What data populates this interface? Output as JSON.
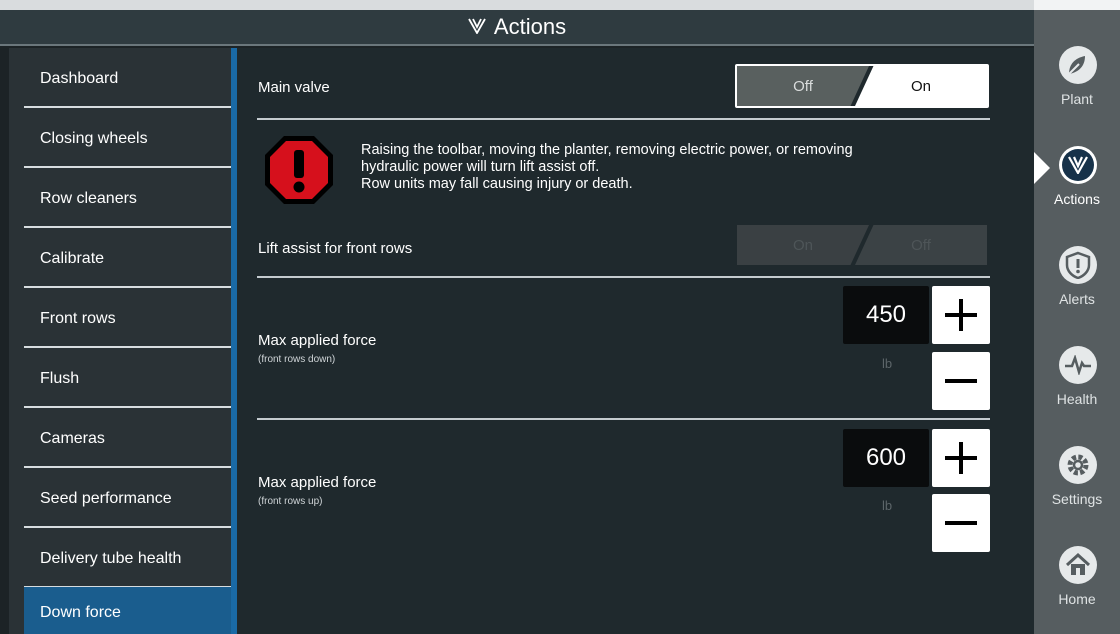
{
  "header": {
    "title": "Actions",
    "icon": "actions-icon"
  },
  "sidebar": {
    "items": [
      {
        "label": "Dashboard"
      },
      {
        "label": "Closing wheels"
      },
      {
        "label": "Row cleaners"
      },
      {
        "label": "Calibrate"
      },
      {
        "label": "Front rows"
      },
      {
        "label": "Flush"
      },
      {
        "label": "Cameras"
      },
      {
        "label": "Seed performance"
      },
      {
        "label": "Delivery tube health"
      },
      {
        "label": "Down force"
      }
    ],
    "active": "Down force"
  },
  "main": {
    "main_valve": {
      "label": "Main valve",
      "off_label": "Off",
      "on_label": "On",
      "selected": "On"
    },
    "warning": {
      "icon": "warning-octagon-icon",
      "line1": "Raising the toolbar, moving the planter, removing electric power, or removing",
      "line2": "hydraulic power will turn lift assist off.",
      "line3": "Row units may fall causing injury or death."
    },
    "lift_assist": {
      "label": "Lift assist for front rows",
      "on_label": "On",
      "off_label": "Off",
      "enabled": false
    },
    "force_down": {
      "label": "Max applied force",
      "sublabel": "(front rows down)",
      "value": "450",
      "unit": "lb"
    },
    "force_up": {
      "label": "Max applied force",
      "sublabel": "(front rows up)",
      "value": "600",
      "unit": "lb"
    }
  },
  "rightbar": {
    "items": [
      {
        "label": "Plant",
        "icon": "plant-icon"
      },
      {
        "label": "Actions",
        "icon": "actions-icon"
      },
      {
        "label": "Alerts",
        "icon": "alerts-shield-icon"
      },
      {
        "label": "Health",
        "icon": "health-pulse-icon"
      },
      {
        "label": "Settings",
        "icon": "gear-icon"
      },
      {
        "label": "Home",
        "icon": "home-icon"
      }
    ],
    "active": "Actions"
  },
  "colors": {
    "accent": "#1a5d8e",
    "warning": "#d6101c",
    "background": "#1f292d"
  }
}
